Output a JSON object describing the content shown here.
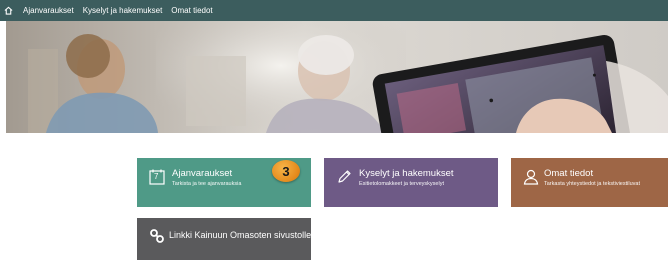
{
  "nav": {
    "home_icon": "home-icon",
    "items": [
      {
        "label": "Ajanvaraukset"
      },
      {
        "label": "Kyselyt ja hakemukset"
      },
      {
        "label": "Omat tiedot"
      }
    ]
  },
  "hero": {
    "description_icon": "hero-photo"
  },
  "tiles": [
    {
      "title": "Ajanvaraukset",
      "subtitle": "Tarkista ja tee ajanvarauksia",
      "icon": "calendar-icon",
      "icon_text": "7",
      "color": "#4f9a87"
    },
    {
      "title": "Kyselyt ja hakemukset",
      "subtitle": "Esitietolomakkeet ja terveyskyselyt",
      "icon": "pencil-icon",
      "color": "#6e5a86"
    },
    {
      "title": "Omat tiedot",
      "subtitle": "Tarkasta yhteystiedot ja tekstiviestiluvat",
      "icon": "person-icon",
      "color": "#9e6646"
    },
    {
      "title": "Linkki Kainuun Omasoten sivustolle",
      "subtitle": "",
      "icon": "link-icon",
      "color": "#5a5a5c"
    }
  ],
  "badge": {
    "value": "3"
  }
}
